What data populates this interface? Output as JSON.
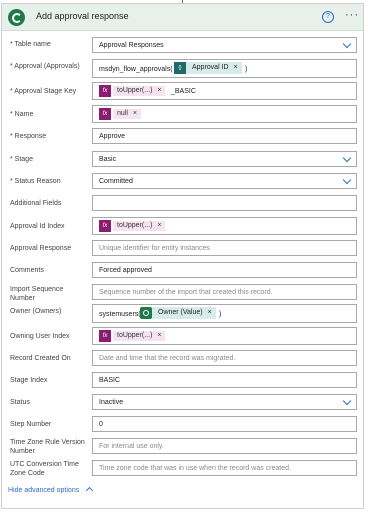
{
  "header": {
    "title": "Add approval response",
    "help": "?",
    "more": "···"
  },
  "fields": [
    {
      "label": "* Table name",
      "value": "Approval Responses",
      "kind": "select"
    },
    {
      "label": "* Approval (Approvals)",
      "value": "msdyn_flow_approvals(",
      "token": "Approval ID",
      "suffix": ")"
    },
    {
      "label": "* Approval Stage Key",
      "token": "toUpper(...)",
      "suffix": "_BASIC"
    },
    {
      "label": "* Name",
      "token": "null"
    },
    {
      "label": "* Response",
      "value": "Approve"
    },
    {
      "label": "* Stage",
      "value": "Basic",
      "kind": "select"
    },
    {
      "label": "* Status Reason",
      "value": "Committed",
      "kind": "select"
    },
    {
      "label": "Additional Fields",
      "value": ""
    },
    {
      "label": "Approval Id Index",
      "token": "toUpper(...)"
    },
    {
      "label": "Approval Response",
      "placeholder": "Unique identifier for entity instances"
    },
    {
      "label": "Comments",
      "value": "Forced approved"
    },
    {
      "label": "Import Sequence Number",
      "placeholder": "Sequence number of the import that created this record."
    },
    {
      "label": "Owner (Owners)",
      "value": "systemusers(",
      "token": "Owner (Value)",
      "suffix": ")"
    },
    {
      "label": "Owning User Index",
      "token": "toUpper(...)"
    },
    {
      "label": "Record Created On",
      "placeholder": "Date and time that the record was migrated."
    },
    {
      "label": "Stage Index",
      "value": "BASIC"
    },
    {
      "label": "Status",
      "value": "Inactive",
      "kind": "select"
    },
    {
      "label": "Step Number",
      "value": "0"
    },
    {
      "label": "Time Zone Rule Version Number",
      "placeholder": "For internal use only."
    },
    {
      "label": "UTC Conversion Time Zone Code",
      "placeholder": "Time zone code that was in use when the record was created."
    }
  ],
  "fx_label": "fx",
  "teal_icon_label": "{}",
  "token_remove": "×",
  "footer": {
    "hide_advanced": "Hide advanced options"
  }
}
